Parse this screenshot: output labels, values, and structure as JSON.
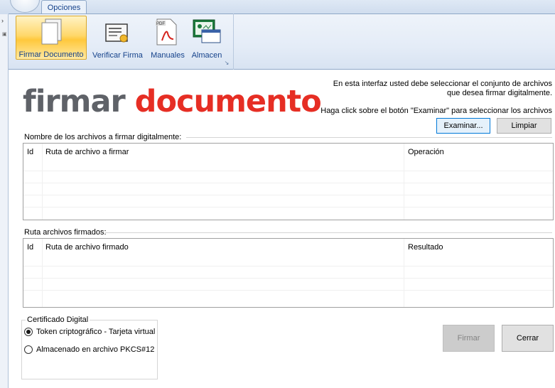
{
  "ribbon": {
    "tab_label": "Opciones",
    "buttons": [
      {
        "label": "Firmar Documento",
        "icon": "document-pages-icon"
      },
      {
        "label": "Verificar Firma",
        "icon": "certificate-icon"
      },
      {
        "label": "Manuales",
        "icon": "pdf-file-icon"
      },
      {
        "label": "Almacen",
        "icon": "certificate-store-icon"
      }
    ],
    "accent_color": "#ffd86b",
    "text_color": "#15428b"
  },
  "form": {
    "title_part1": "firmar",
    "title_part2": "documento",
    "title_colors": {
      "part1": "#5f6268",
      "part2": "#e62e24"
    },
    "info_line1": "En esta interfaz usted debe seleccionar el conjunto de archivos",
    "info_line2": "que  desea firmar digitalmente.",
    "info_line3": "Haga click sobre el botón \"Examinar\" para seleccionar los archivos",
    "examinar_label": "Examinar...",
    "limpiar_label": "Limpiar",
    "files_group_title": "Nombre de los archivos a firmar digitalmente:",
    "files_columns": [
      "Id",
      "Ruta de archivo a firmar",
      "Operación"
    ],
    "signed_group_title": "Ruta archivos firmados:",
    "signed_columns": [
      "Id",
      "Ruta de archivo firmado",
      "Resultado"
    ],
    "cert_group_title": "Certificado Digital",
    "cert_options": [
      {
        "label": "Token criptográfico - Tarjeta virtual",
        "selected": true
      },
      {
        "label": "Almacenado en archivo PKCS#12",
        "selected": false
      }
    ],
    "firmar_label": "Firmar",
    "cerrar_label": "Cerrar"
  }
}
